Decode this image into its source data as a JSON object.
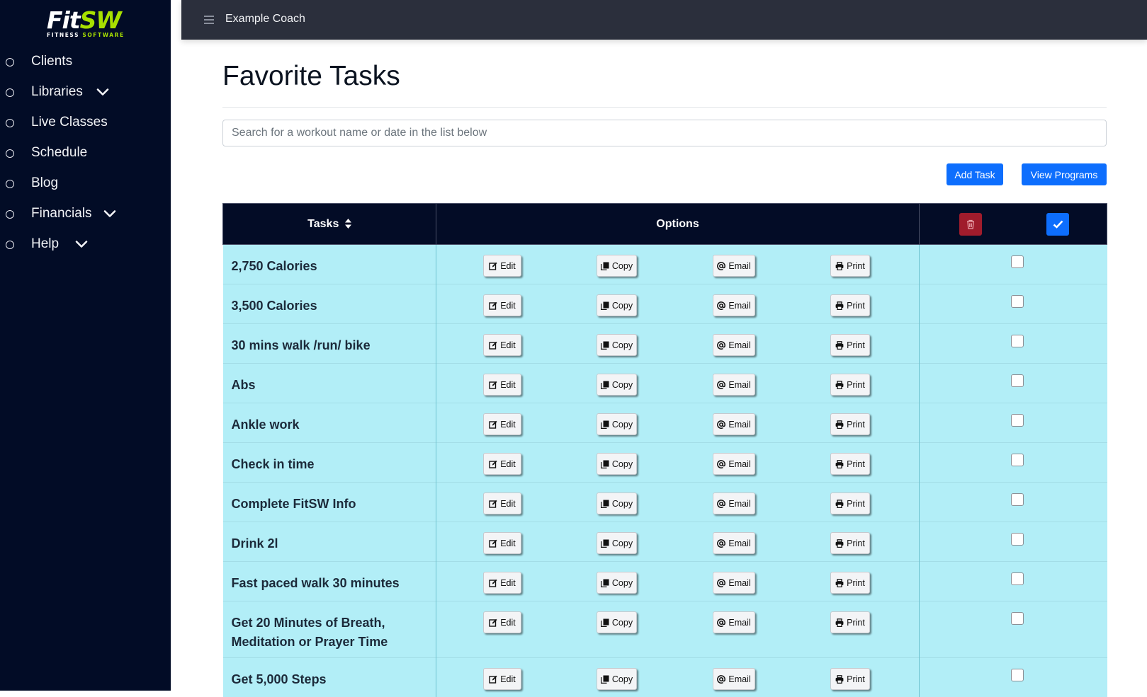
{
  "brand": {
    "name_main": "Fit",
    "name_accent": "SW",
    "tagline_main": "FITNESS ",
    "tagline_accent": "SOFTWARE"
  },
  "sidebar": {
    "items": [
      {
        "label": "Clients",
        "has_chevron": false
      },
      {
        "label": "Libraries",
        "has_chevron": true
      },
      {
        "label": "Live Classes",
        "has_chevron": false
      },
      {
        "label": "Schedule",
        "has_chevron": false
      },
      {
        "label": "Blog",
        "has_chevron": false
      },
      {
        "label": "Financials",
        "has_chevron": true
      },
      {
        "label": "Help",
        "has_chevron": true
      }
    ]
  },
  "topbar": {
    "user_name": "Example Coach",
    "menu_icon": "hamburger-icon"
  },
  "page": {
    "title": "Favorite Tasks",
    "search_placeholder": "Search for a workout name or date in the list below",
    "search_value": "",
    "add_task_label": "Add Task",
    "view_programs_label": "View Programs"
  },
  "table": {
    "headers": {
      "tasks": "Tasks",
      "options": "Options"
    },
    "row_actions": {
      "edit": "Edit",
      "copy": "Copy",
      "email": "Email",
      "print": "Print"
    },
    "rows": [
      {
        "name": "2,750 Calories",
        "checked": false
      },
      {
        "name": "3,500 Calories",
        "checked": false
      },
      {
        "name": "30 mins walk /run/ bike",
        "checked": false
      },
      {
        "name": "Abs",
        "checked": false
      },
      {
        "name": "Ankle work",
        "checked": false
      },
      {
        "name": "Check in time",
        "checked": false
      },
      {
        "name": "Complete FitSW Info",
        "checked": false
      },
      {
        "name": "Drink 2l",
        "checked": false
      },
      {
        "name": "Fast paced walk 30 minutes",
        "checked": false
      },
      {
        "name": "Get 20 Minutes of Breath, Meditation or Prayer Time",
        "checked": false
      },
      {
        "name": "Get 5,000 Steps",
        "checked": false
      }
    ]
  },
  "colors": {
    "sidebar_bg": "#020c26",
    "topbar_bg": "#2b2f3c",
    "row_bg": "#b2eef7",
    "primary": "#0d6efd",
    "danger": "#a01c2c"
  }
}
